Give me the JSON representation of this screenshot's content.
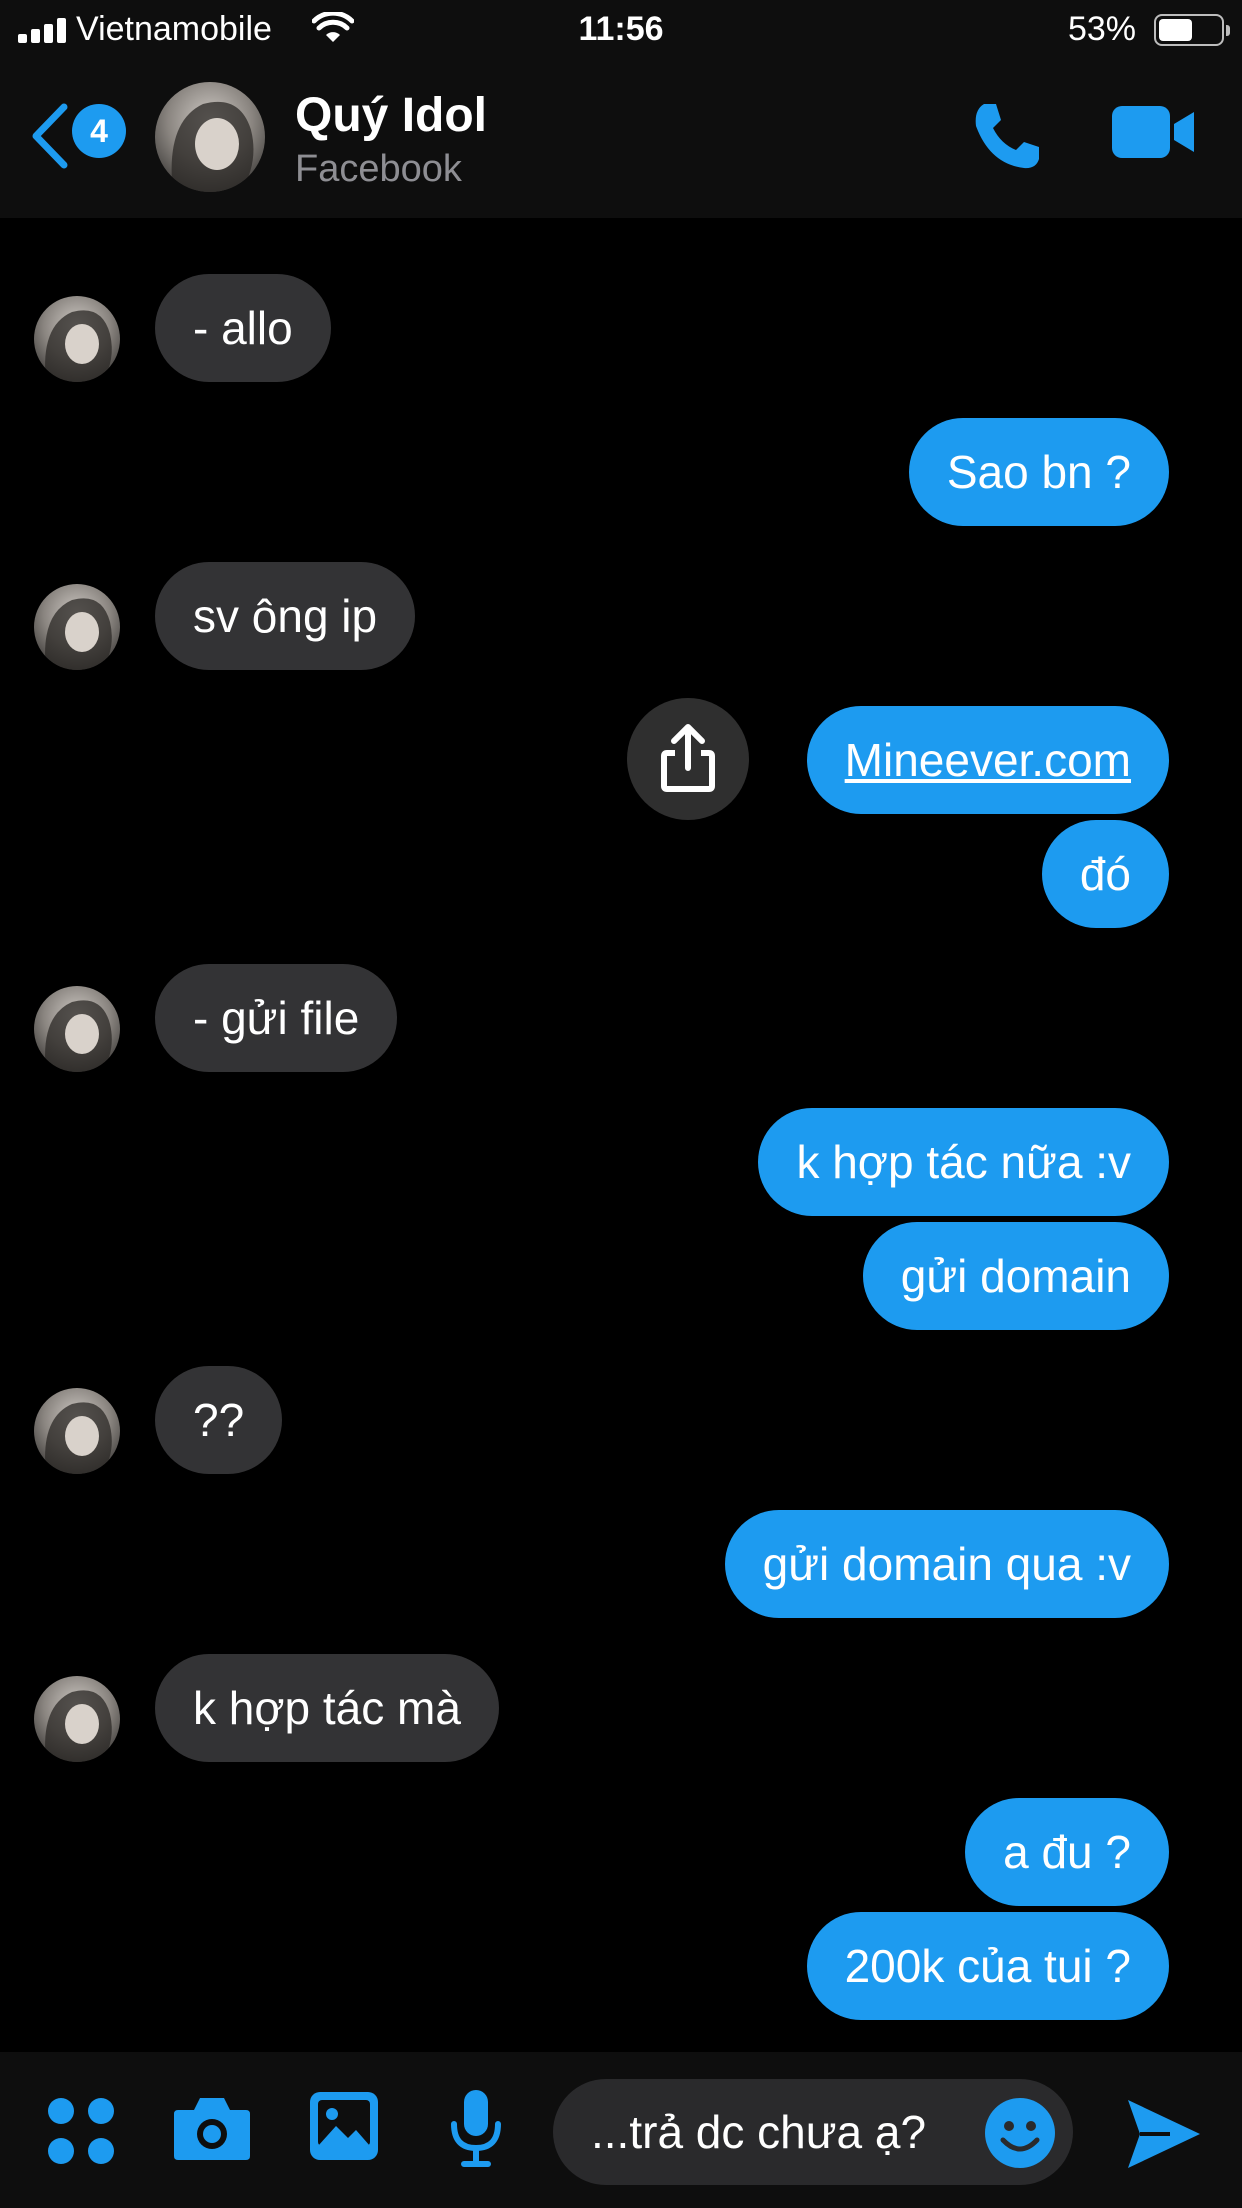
{
  "status_bar": {
    "carrier": "Vietnamobile",
    "time": "11:56",
    "battery_percent": "53%",
    "battery_level": 0.53
  },
  "header": {
    "back_badge": "4",
    "contact_name": "Quý Idol",
    "contact_sub": "Facebook"
  },
  "messages": [
    {
      "from": "them",
      "text": "- allo"
    },
    {
      "from": "me",
      "text": "Sao bn ?"
    },
    {
      "from": "them",
      "text": "sv ông ip"
    },
    {
      "from": "me",
      "text": "Mineever.com",
      "link": true
    },
    {
      "from": "me",
      "text": "đó"
    },
    {
      "from": "them",
      "text": "- gửi file"
    },
    {
      "from": "me",
      "text": "k hợp tác nữa :v"
    },
    {
      "from": "me",
      "text": "gửi domain"
    },
    {
      "from": "them",
      "text": "??"
    },
    {
      "from": "me",
      "text": "gửi domain qua :v"
    },
    {
      "from": "them",
      "text": "k hợp tác mà"
    },
    {
      "from": "me",
      "text": "a đu ?"
    },
    {
      "from": "me",
      "text": "200k của tui ?"
    }
  ],
  "composer": {
    "placeholder": "...trả dc chưa ạ?"
  },
  "colors": {
    "accent": "#1d9bf0",
    "incoming_bubble": "#333335",
    "background": "#000000",
    "bar": "#0e0e0e"
  },
  "icons": [
    "signal-icon",
    "wifi-icon",
    "battery-icon",
    "back-chevron-icon",
    "phone-icon",
    "video-camera-icon",
    "share-icon",
    "apps-icon",
    "camera-icon",
    "gallery-icon",
    "microphone-icon",
    "emoji-icon",
    "send-icon"
  ]
}
